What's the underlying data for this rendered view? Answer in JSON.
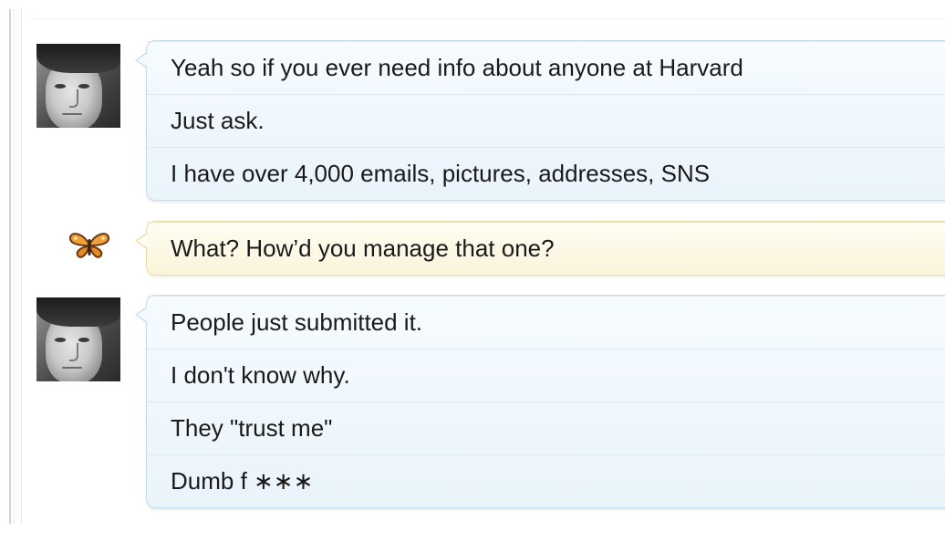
{
  "conversation": {
    "groups": [
      {
        "sender": "self",
        "avatar_icon": "avatar-photo",
        "bubble_color": "#eaf4fb",
        "lines": [
          "Yeah so if you ever need info about anyone at Harvard",
          "Just ask.",
          "I have over 4,000 emails, pictures, addresses, SNS"
        ]
      },
      {
        "sender": "other",
        "avatar_icon": "butterfly-icon",
        "bubble_color": "#fbf4da",
        "lines": [
          "What? How’d you manage that one?"
        ]
      },
      {
        "sender": "self",
        "avatar_icon": "avatar-photo",
        "bubble_color": "#eaf4fb",
        "lines": [
          "People just submitted it.",
          "I don't know why.",
          "They \"trust me\"",
          "Dumb f ∗∗∗"
        ]
      }
    ]
  },
  "colors": {
    "blue_bubble_border": "#c7dce9",
    "yellow_bubble_border": "#eadcaa",
    "text": "#1a1a1a",
    "butterfly_orange": "#f0a23a"
  }
}
